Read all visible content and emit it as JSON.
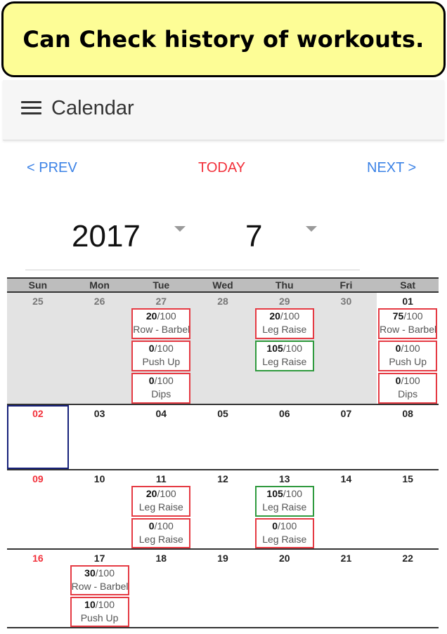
{
  "banner": {
    "text": "Can Check history of workouts."
  },
  "appbar": {
    "title": "Calendar"
  },
  "nav": {
    "prev": "< PREV",
    "today": "TODAY",
    "next": "NEXT >"
  },
  "selectors": {
    "year": "2017",
    "month": "7"
  },
  "weekdays": [
    "Sun",
    "Mon",
    "Tue",
    "Wed",
    "Thu",
    "Fri",
    "Sat"
  ],
  "weeks": [
    {
      "height_hint": "tall",
      "days": [
        {
          "num": "25",
          "out": true,
          "entries": []
        },
        {
          "num": "26",
          "out": true,
          "entries": []
        },
        {
          "num": "27",
          "out": true,
          "entries": [
            {
              "score": "20",
              "total": "/100",
              "name": "Row - Barbell",
              "status": "incomplete"
            },
            {
              "score": "0",
              "total": "/100",
              "name": "Push Up",
              "status": "incomplete"
            },
            {
              "score": "0",
              "total": "/100",
              "name": "Dips",
              "status": "incomplete"
            }
          ]
        },
        {
          "num": "28",
          "out": true,
          "entries": []
        },
        {
          "num": "29",
          "out": true,
          "entries": [
            {
              "score": "20",
              "total": "/100",
              "name": "Leg Raise",
              "status": "incomplete"
            },
            {
              "score": "105",
              "total": "/100",
              "name": "Leg Raise",
              "status": "complete"
            }
          ]
        },
        {
          "num": "30",
          "out": true,
          "entries": []
        },
        {
          "num": "01",
          "out": false,
          "entries": [
            {
              "score": "75",
              "total": "/100",
              "name": "Row - Barbell",
              "status": "incomplete"
            },
            {
              "score": "0",
              "total": "/100",
              "name": "Push Up",
              "status": "incomplete"
            },
            {
              "score": "0",
              "total": "/100",
              "name": "Dips",
              "status": "incomplete"
            }
          ]
        }
      ]
    },
    {
      "days": [
        {
          "num": "02",
          "sunday": true,
          "selected": true,
          "entries": []
        },
        {
          "num": "03",
          "entries": []
        },
        {
          "num": "04",
          "entries": []
        },
        {
          "num": "05",
          "entries": []
        },
        {
          "num": "06",
          "entries": []
        },
        {
          "num": "07",
          "entries": []
        },
        {
          "num": "08",
          "entries": []
        }
      ]
    },
    {
      "days": [
        {
          "num": "09",
          "sunday": true,
          "entries": []
        },
        {
          "num": "10",
          "entries": []
        },
        {
          "num": "11",
          "entries": [
            {
              "score": "20",
              "total": "/100",
              "name": "Leg Raise",
              "status": "incomplete"
            },
            {
              "score": "0",
              "total": "/100",
              "name": "Leg Raise",
              "status": "incomplete"
            }
          ]
        },
        {
          "num": "12",
          "entries": []
        },
        {
          "num": "13",
          "entries": [
            {
              "score": "105",
              "total": "/100",
              "name": "Leg Raise",
              "status": "complete"
            },
            {
              "score": "0",
              "total": "/100",
              "name": "Leg Raise",
              "status": "incomplete"
            }
          ]
        },
        {
          "num": "14",
          "entries": []
        },
        {
          "num": "15",
          "entries": []
        }
      ]
    },
    {
      "days": [
        {
          "num": "16",
          "sunday": true,
          "entries": []
        },
        {
          "num": "17",
          "entries": [
            {
              "score": "30",
              "total": "/100",
              "name": "Row - Barbell",
              "status": "incomplete"
            },
            {
              "score": "10",
              "total": "/100",
              "name": "Push Up",
              "status": "incomplete"
            }
          ]
        },
        {
          "num": "18",
          "entries": []
        },
        {
          "num": "19",
          "entries": []
        },
        {
          "num": "20",
          "entries": []
        },
        {
          "num": "21",
          "entries": []
        },
        {
          "num": "22",
          "entries": []
        }
      ]
    }
  ],
  "colors": {
    "accent_blue": "#3b82e6",
    "today_red": "#f2303a",
    "incomplete_border": "#e53a43",
    "complete_border": "#2f9a3e",
    "selected_border": "#16207a",
    "banner_bg": "#fdfd96"
  }
}
